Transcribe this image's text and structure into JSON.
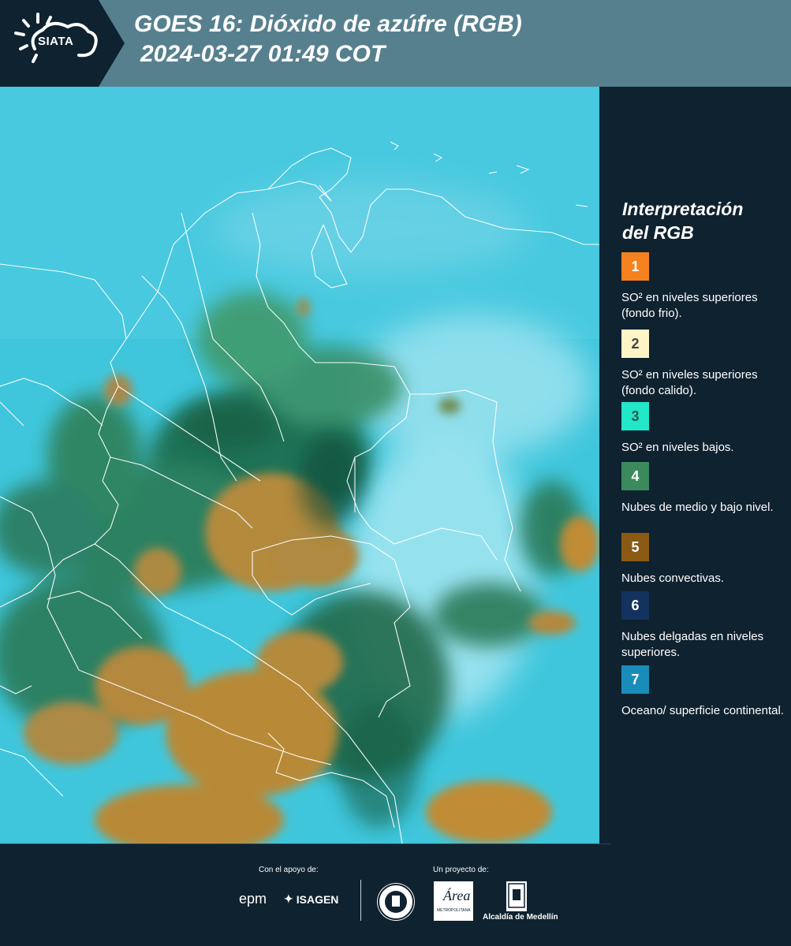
{
  "header": {
    "logo_text": "SIATA",
    "title_line1": "GOES 16: Dióxido de azúfre (RGB)",
    "title_line2": "2024-03-27 01:49 COT",
    "background_color": "#57808f"
  },
  "legend": {
    "title_line1": "Interpretación",
    "title_line2": "del RGB",
    "items": [
      {
        "number": "1",
        "color": "#f5821f",
        "number_color": "#ffffff",
        "text": "SO² en niveles superiores (fondo frio)."
      },
      {
        "number": "2",
        "color": "#fdf5c8",
        "number_color": "#444444",
        "text": "SO² en niveles superiores (fondo calido)."
      },
      {
        "number": "3",
        "color": "#22e6c8",
        "number_color": "#2a5a55",
        "text": "SO² en niveles bajos."
      },
      {
        "number": "4",
        "color": "#3a8a5e",
        "number_color": "#ffffff",
        "text": "Nubes de medio y bajo nivel."
      },
      {
        "number": "5",
        "color": "#8a5a14",
        "number_color": "#ffffff",
        "text": "Nubes convectivas."
      },
      {
        "number": "6",
        "color": "#14325e",
        "number_color": "#ffffff",
        "text": "Nubes delgadas en niveles superiores."
      },
      {
        "number": "7",
        "color": "#1a8cba",
        "number_color": "#ffffff",
        "text": "Oceano/ superficie continental."
      }
    ]
  },
  "footer": {
    "support_label": "Con el apoyo de:",
    "project_label": "Un proyecto de:",
    "sponsor_epm": "epm",
    "sponsor_isagen": "ISAGEN",
    "area_name": "Área",
    "area_subtitle": "METROPOLITANA",
    "alcaldia": "Alcaldía de Medellín"
  },
  "map": {
    "image_type": "satellite-rgb-composite",
    "ocean_color": "#3fc6dc",
    "convective_color": "#b48a3c",
    "low_cloud_color": "#1f6a4a",
    "boundary_color": "#ffffff"
  }
}
